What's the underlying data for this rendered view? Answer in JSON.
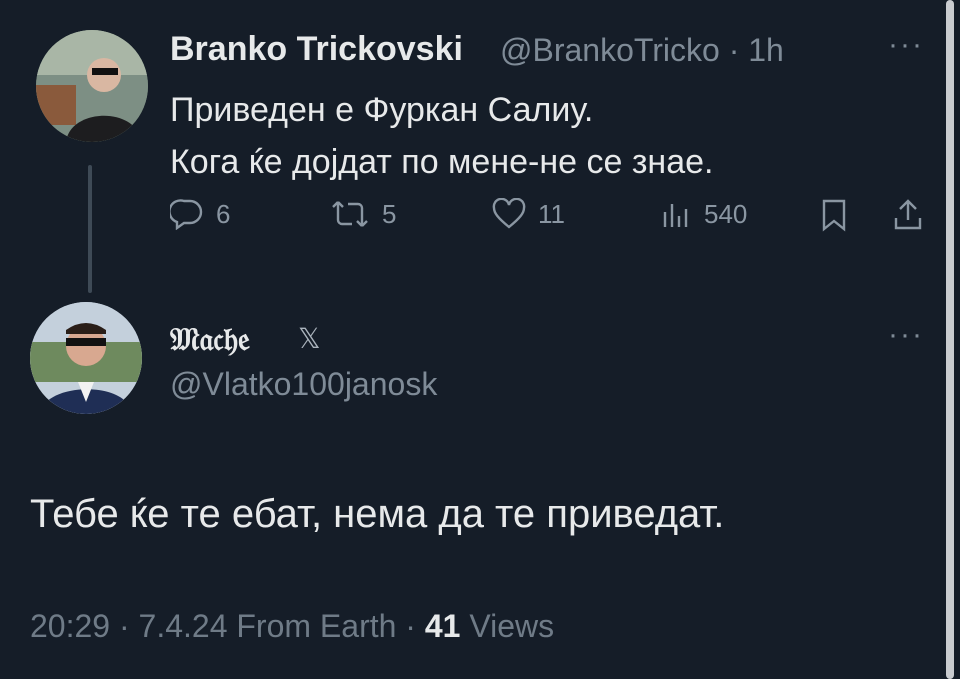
{
  "tweet": {
    "author_name": "Branko Trickovski",
    "author_handle": "@BrankoTricko",
    "separator": "·",
    "age": "1h",
    "line1": "Приведен е Фуркан Салиу.",
    "line2": "Кога ќе дојдат по мене-не се знае.",
    "replies": "6",
    "reposts": "5",
    "likes": "11",
    "views": "540",
    "more": "···"
  },
  "reply": {
    "author_name": "𝔐𝔞𝔠𝔥𝔢",
    "badge": "𝕏",
    "author_handle": "@Vlatko100janosk",
    "text": "Тебе ќе те ебат, нема да те приведат.",
    "time": "20:29",
    "date": "7.4.24",
    "source": "From Earth",
    "views_count": "41",
    "views_label": "Views",
    "more": "···"
  },
  "icons": [
    "reply-icon",
    "repost-icon",
    "like-icon",
    "views-icon",
    "bookmark-icon",
    "share-icon"
  ]
}
